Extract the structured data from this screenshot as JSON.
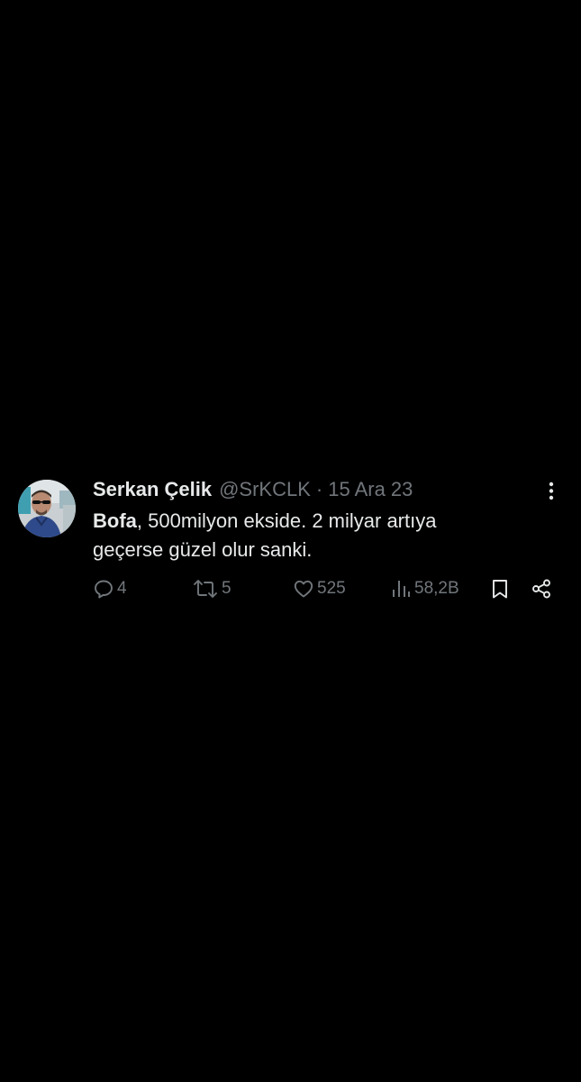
{
  "tweet": {
    "author_name": "Serkan Çelik",
    "author_handle": "@SrKCLK",
    "separator": "·",
    "date": "15 Ara 23",
    "text_bold": "Bofa",
    "text_line1_rest": ", 500milyon ekside. 2 milyar artıya",
    "text_line2": "geçerse güzel olur sanki.",
    "replies": "4",
    "retweets": "5",
    "likes": "525",
    "views": "58,2B"
  },
  "icons": {
    "more": "more-vertical-icon",
    "reply": "reply-icon",
    "retweet": "retweet-icon",
    "like": "heart-icon",
    "views": "views-icon",
    "bookmark": "bookmark-icon",
    "share": "share-icon"
  },
  "colors": {
    "background": "#000000",
    "primary_text": "#e7e9ea",
    "secondary_text": "#71767b"
  }
}
